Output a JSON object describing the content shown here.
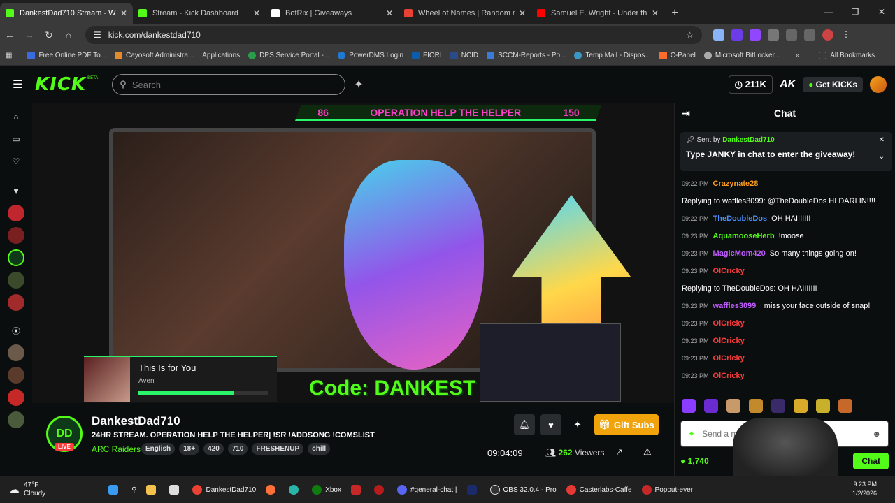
{
  "browser": {
    "tabs": [
      {
        "title": "DankestDad710 Stream - W",
        "color": "#53fc18"
      },
      {
        "title": "Stream - Kick Dashboard",
        "color": "#53fc18"
      },
      {
        "title": "BotRix | Giveaways",
        "color": "#ffffff"
      },
      {
        "title": "Wheel of Names | Random nam",
        "color": "#e94235"
      },
      {
        "title": "Samuel E. Wright - Under the S",
        "color": "#ff0000"
      }
    ],
    "url": "kick.com/dankestdad710",
    "bookmarks": [
      "Free Online PDF To...",
      "Cayosoft Administra...",
      "Applications",
      "DPS Service Portal -...",
      "PowerDMS Login",
      "FIORI",
      "NCID",
      "SCCM-Reports - Po...",
      "Temp Mail - Dispos...",
      "C-Panel",
      "Microsoft BitLocker..."
    ],
    "all_bookmarks": "All Bookmarks"
  },
  "kick": {
    "logo": "KICK",
    "beta": "BETA",
    "search_placeholder": "Search",
    "points": "211K",
    "get_kicks": "Get KICKs"
  },
  "stream": {
    "overlay_left": "86",
    "overlay_title": "OPERATION HELP THE HELPER",
    "overlay_right": "150",
    "song": "This Is for You",
    "artist": "Aven",
    "song_progress": 0.73,
    "code": "Code: DANKEST",
    "channel": "DankestDad710",
    "live": "LIVE",
    "title": "24HR STREAM. OPERATION HELP THE HELPER| !SR !ADDSONG !COMSLIST",
    "category": "ARC Raiders",
    "tags": [
      "English",
      "18+",
      "420",
      "710",
      "FRESHENUP",
      "chill"
    ],
    "gift": "Gift Subs",
    "uptime": "09:04:09",
    "viewers_count": "262",
    "viewers_label": "Viewers"
  },
  "chat": {
    "header": "Chat",
    "pinned_label": "Sent by",
    "pinned_user": "DankestDad710",
    "pinned_msg": "Type JANKY in chat to enter the giveaway!",
    "messages": [
      {
        "time": "09:22 PM",
        "user": "Crazynate28",
        "color": "#ff9f1a",
        "text": "",
        "reply": "Replying to waffles3099: @TheDoubleDos HI DARLIN!!!!"
      },
      {
        "time": "09:22 PM",
        "user": "TheDoubleDos",
        "color": "#4a90ff",
        "text": "OH HAIIIIIII",
        "reply": ""
      },
      {
        "time": "09:23 PM",
        "user": "AquamooseHerb",
        "color": "#53fc18",
        "text": "!moose",
        "reply": ""
      },
      {
        "time": "09:23 PM",
        "user": "MagicMom420",
        "color": "#c15cff",
        "text": "So many things going on!",
        "reply": ""
      },
      {
        "time": "09:23 PM",
        "user": "OlCricky",
        "color": "#ff3b3b",
        "text": "",
        "reply": "Replying to TheDoubleDos: OH HAIIIIIII"
      },
      {
        "time": "09:23 PM",
        "user": "waffles3099",
        "color": "#c15cff",
        "text": "i miss your face outside of snap!",
        "reply": ""
      },
      {
        "time": "09:23 PM",
        "user": "OlCricky",
        "color": "#ff3b3b",
        "text": "",
        "reply": ""
      },
      {
        "time": "09:23 PM",
        "user": "OlCricky",
        "color": "#ff3b3b",
        "text": "",
        "reply": ""
      },
      {
        "time": "09:23 PM",
        "user": "OlCricky",
        "color": "#ff3b3b",
        "text": "",
        "reply": ""
      },
      {
        "time": "09:23 PM",
        "user": "OlCricky",
        "color": "#ff3b3b",
        "text": "",
        "reply": ""
      }
    ],
    "input_placeholder": "Send a message",
    "kicks_balance": "1,740",
    "chat_button": "Chat"
  },
  "taskbar": {
    "weather_temp": "47°F",
    "weather_desc": "Cloudy",
    "apps": [
      "DankestDad710",
      "Xbox",
      "#general-chat |",
      "OBS 32.0.4 - Pro",
      "Casterlabs-Caffe",
      "Popout-ever"
    ],
    "time": "9:23 PM",
    "date": "1/2/2026"
  }
}
